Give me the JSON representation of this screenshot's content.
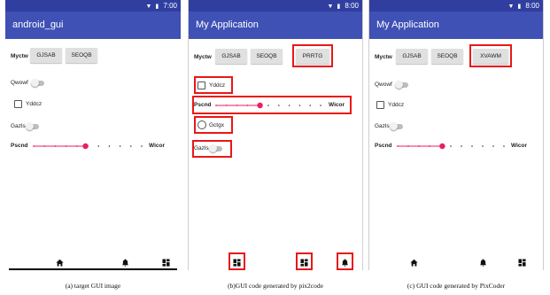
{
  "colors": {
    "accent": "#3f51b5",
    "dark": "#303f9f",
    "highlight": "#e81818",
    "slider_accent": "#e91e63"
  },
  "panels": [
    {
      "status_time": "7:00",
      "status_icons": "▼ ▮",
      "title": "android_gui",
      "row_label": "Myctw",
      "buttons": [
        "GJSAB",
        "SEOQB"
      ],
      "switch_label_1": "Qwowf",
      "checkbox_label": "Yddcz",
      "switch_label_2": "Gazls",
      "slider_label": "Pscnd",
      "slider_end": "Wicor",
      "slider_value": 0.48,
      "nav_icons": [
        "home-icon",
        "bell-icon",
        "grid-icon"
      ],
      "caption": "(a) target GUI image"
    },
    {
      "status_time": "8:00",
      "status_icons": "▼ ▮",
      "title": "My Application",
      "row_label": "Myctw",
      "buttons": [
        "GJSAB",
        "SEOQB",
        "PRRTG"
      ],
      "checkbox_label": "Yddcz",
      "slider_label": "Pscnd",
      "slider_end": "Wicor",
      "slider_value": 0.42,
      "radio_label": "Gctgx",
      "switch_label": "Gazls",
      "nav_icons": [
        "grid-icon",
        "grid-icon",
        "bell-icon"
      ],
      "caption": "(b)GUI code generated by pix2code"
    },
    {
      "status_time": "8:00",
      "status_icons": "▼ ▮",
      "title": "My Application",
      "row_label": "Myctw",
      "buttons": [
        "GJSAB",
        "SEOQB",
        "XVAWM"
      ],
      "switch_label_1": "Qwowf",
      "checkbox_label": "Yddcz",
      "switch_label_2": "Gazls",
      "slider_label": "Pscnd",
      "slider_end": "Wicor",
      "slider_value": 0.42,
      "nav_icons": [
        "home-icon",
        "bell-icon",
        "grid-icon"
      ],
      "caption": "(c) GUI code generated by PixCoder"
    }
  ]
}
